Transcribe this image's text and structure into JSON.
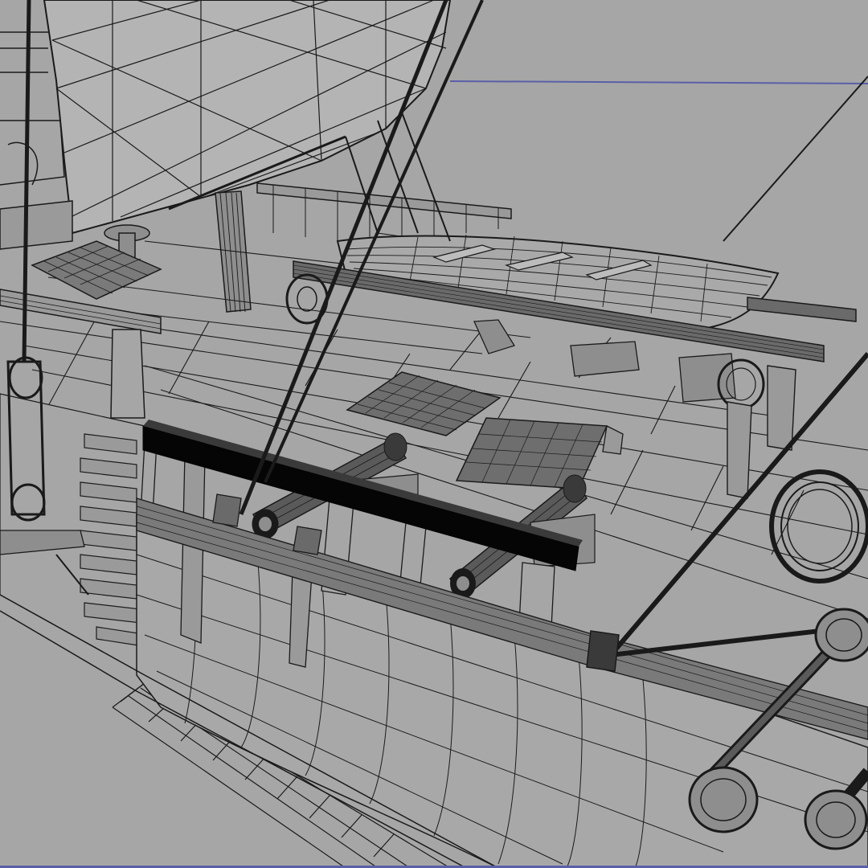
{
  "viewport": {
    "background": "#a6a6a6",
    "wire_color": "#1a1a1a",
    "wire_light": "#3a3a3a",
    "sail_fill": "#b4b4b4",
    "plank_fill": "#9a9a9a",
    "solid_black": "#050505",
    "guide_line_color": "#5a5fa8",
    "render_mode": "wireframe-on-shaded"
  },
  "scene": {
    "subject": "sailing-ship-3d-model",
    "objects": [
      {
        "name": "mainsail",
        "icon": "sail-icon"
      },
      {
        "name": "mast",
        "icon": "mast-icon"
      },
      {
        "name": "rowboat",
        "icon": "boat-icon"
      },
      {
        "name": "cannon-port",
        "icon": "cannon-icon"
      },
      {
        "name": "cannon-starboard",
        "icon": "cannon-icon"
      },
      {
        "name": "deck-grating-left",
        "icon": "grid-icon"
      },
      {
        "name": "deck-grating-right",
        "icon": "grid-icon"
      },
      {
        "name": "coiled-rope",
        "icon": "rope-coil-icon"
      },
      {
        "name": "capstan",
        "icon": "capstan-icon"
      },
      {
        "name": "hull",
        "icon": "hull-icon"
      },
      {
        "name": "gunwale-rail",
        "icon": "rail-icon"
      },
      {
        "name": "pulley-block",
        "icon": "pulley-icon"
      },
      {
        "name": "deadeyes",
        "icon": "deadeye-icon"
      }
    ]
  }
}
